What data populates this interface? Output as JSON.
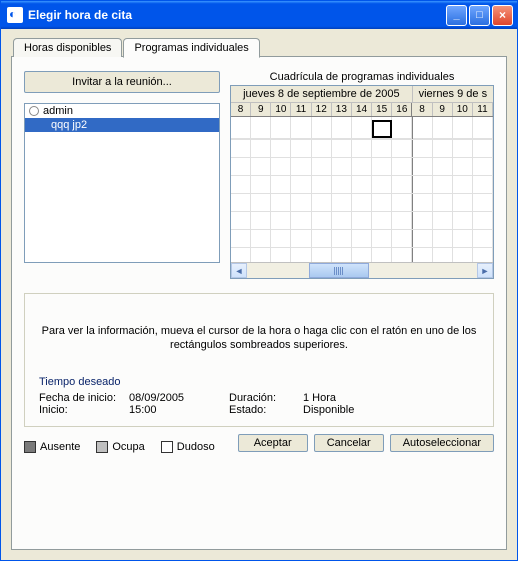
{
  "window": {
    "title": "Elegir hora de cita"
  },
  "tabs": {
    "available": "Horas disponibles",
    "individual": "Programas individuales"
  },
  "invite_button": "Invitar a la reunión...",
  "attendees": [
    {
      "name": "admin",
      "indent": false,
      "selected": false
    },
    {
      "name": "qqq jp2",
      "indent": true,
      "selected": true
    }
  ],
  "grid": {
    "title": "Cuadrícula de programas individuales",
    "days": [
      "jueves 8 de septiembre de 2005",
      "viernes 9 de s"
    ],
    "hours_day1": [
      "8",
      "9",
      "10",
      "11",
      "12",
      "13",
      "14",
      "15",
      "16"
    ],
    "hours_day2": [
      "8",
      "9",
      "10",
      "11"
    ]
  },
  "info": {
    "text": "Para ver la información, mueva el cursor de la hora o haga clic con el ratón en uno de los rectángulos sombreados superiores.",
    "desired_title": "Tiempo deseado",
    "start_date_label": "Fecha de inicio:",
    "start_date_value": "08/09/2005",
    "start_time_label": "Inicio:",
    "start_time_value": "15:00",
    "duration_label": "Duración:",
    "duration_value": "1 Hora",
    "status_label": "Estado:",
    "status_value": "Disponible"
  },
  "legend": {
    "ausente": "Ausente",
    "ocupa": "Ocupa",
    "dudoso": "Dudoso"
  },
  "buttons": {
    "ok": "Aceptar",
    "cancel": "Cancelar",
    "auto": "Autoseleccionar"
  }
}
